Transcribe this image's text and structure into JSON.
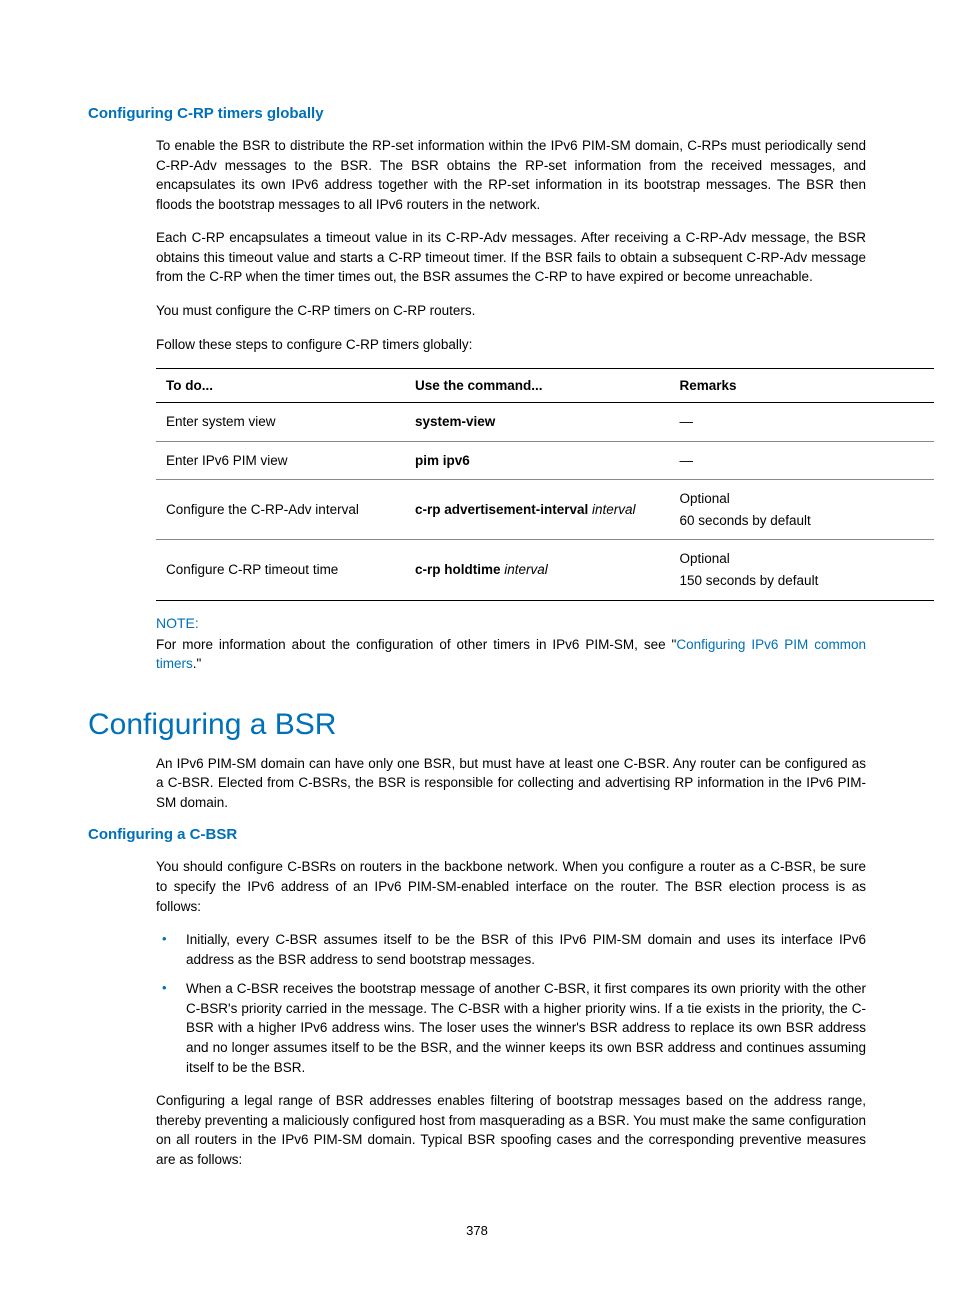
{
  "section1": {
    "heading": "Configuring C-RP timers globally",
    "p1": "To enable the BSR to distribute the RP-set information within the IPv6 PIM-SM domain, C-RPs must periodically send C-RP-Adv messages to the BSR. The BSR obtains the RP-set information from the received messages, and encapsulates its own IPv6 address together with the RP-set information in its bootstrap messages. The BSR then floods the bootstrap messages to all IPv6 routers in the network.",
    "p2": "Each C-RP encapsulates a timeout value in its C-RP-Adv messages. After receiving a C-RP-Adv message, the BSR obtains this timeout value and starts a C-RP timeout timer. If the BSR fails to obtain a subsequent C-RP-Adv message from the C-RP when the timer times out, the BSR assumes the C-RP to have expired or become unreachable.",
    "p3": "You must configure the C-RP timers on C-RP routers.",
    "p4": "Follow these steps to configure C-RP timers globally:"
  },
  "table": {
    "headers": {
      "c1": "To do...",
      "c2": "Use the command...",
      "c3": "Remarks"
    },
    "rows": [
      {
        "c1": "Enter system view",
        "c2_bold": "system-view",
        "c2_ital": "",
        "c3": "—"
      },
      {
        "c1": "Enter IPv6 PIM view",
        "c2_bold": "pim ipv6",
        "c2_ital": "",
        "c3": "—"
      },
      {
        "c1": "Configure the C-RP-Adv interval",
        "c2_bold": "c-rp advertisement-interval",
        "c2_ital": " interval",
        "c3": "Optional\n60 seconds by default"
      },
      {
        "c1": "Configure C-RP timeout time",
        "c2_bold": "c-rp holdtime",
        "c2_ital": " interval",
        "c3": "Optional\n150 seconds by default"
      }
    ]
  },
  "note": {
    "label": "NOTE:",
    "before": "For more information about the configuration of other timers in IPv6 PIM-SM, see \"",
    "link": "Configuring IPv6 PIM common timers",
    "after": ".\""
  },
  "section2": {
    "heading": "Configuring a BSR",
    "p1": "An IPv6 PIM-SM domain can have only one BSR, but must have at least one C-BSR. Any router can be configured as a C-BSR. Elected from C-BSRs, the BSR is responsible for collecting and advertising RP information in the IPv6 PIM-SM domain.",
    "sub_heading": "Configuring a C-BSR",
    "p2": "You should configure C-BSRs on routers in the backbone network. When you configure a router as a C-BSR, be sure to specify the IPv6 address of an IPv6 PIM-SM-enabled interface on the router. The BSR election process is as follows:",
    "bullets": [
      "Initially, every C-BSR assumes itself to be the BSR of this IPv6 PIM-SM domain and uses its interface IPv6 address as the BSR address to send bootstrap messages.",
      "When a C-BSR receives the bootstrap message of another C-BSR, it first compares its own priority with the other C-BSR's priority carried in the message. The C-BSR with a higher priority wins. If a tie exists in the priority, the C-BSR with a higher IPv6 address wins. The loser uses the winner's BSR address to replace its own BSR address and no longer assumes itself to be the BSR, and the winner keeps its own BSR address and continues assuming itself to be the BSR."
    ],
    "p3": "Configuring a legal range of BSR addresses enables filtering of bootstrap messages based on the address range, thereby preventing a maliciously configured host from masquerading as a BSR. You must make the same configuration on all routers in the IPv6 PIM-SM domain. Typical BSR spoofing cases and the corresponding preventive measures are as follows:"
  },
  "page_number": "378"
}
